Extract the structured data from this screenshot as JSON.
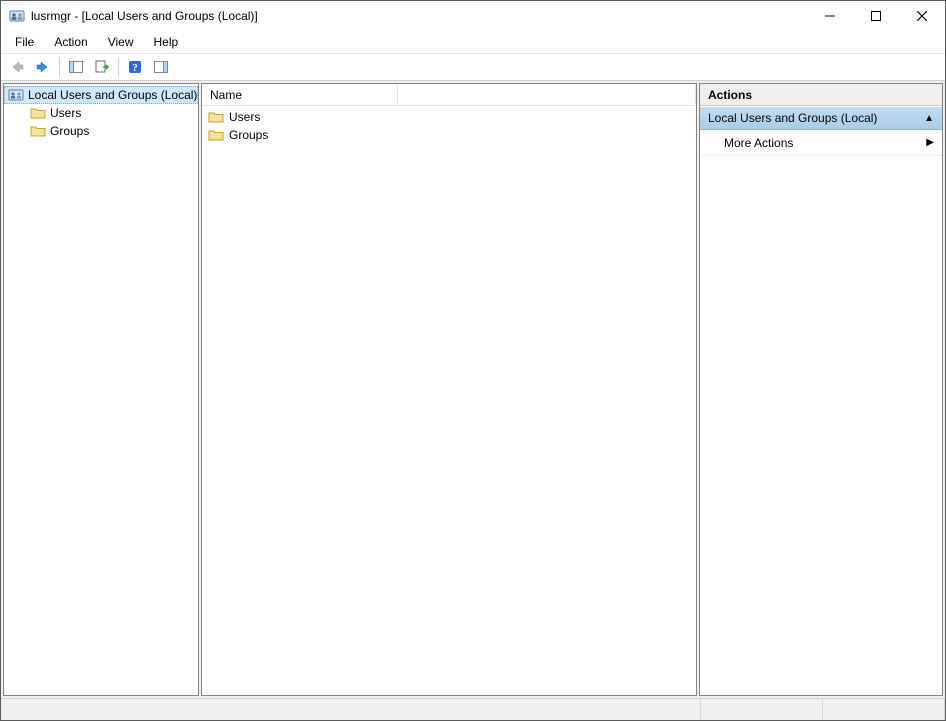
{
  "window": {
    "title": "lusrmgr - [Local Users and Groups (Local)]"
  },
  "menu": {
    "items": [
      "File",
      "Action",
      "View",
      "Help"
    ]
  },
  "toolbar": {
    "back": "Back",
    "forward": "Forward",
    "show_hide_tree": "Show/Hide Console Tree",
    "export_list": "Export List",
    "help": "Help",
    "show_hide_action": "Show/Hide Action Pane"
  },
  "tree": {
    "root": "Local Users and Groups (Local)",
    "children": [
      "Users",
      "Groups"
    ]
  },
  "list": {
    "columns": [
      "Name"
    ],
    "rows": [
      "Users",
      "Groups"
    ]
  },
  "actions": {
    "header": "Actions",
    "group": "Local Users and Groups (Local)",
    "more": "More Actions"
  }
}
